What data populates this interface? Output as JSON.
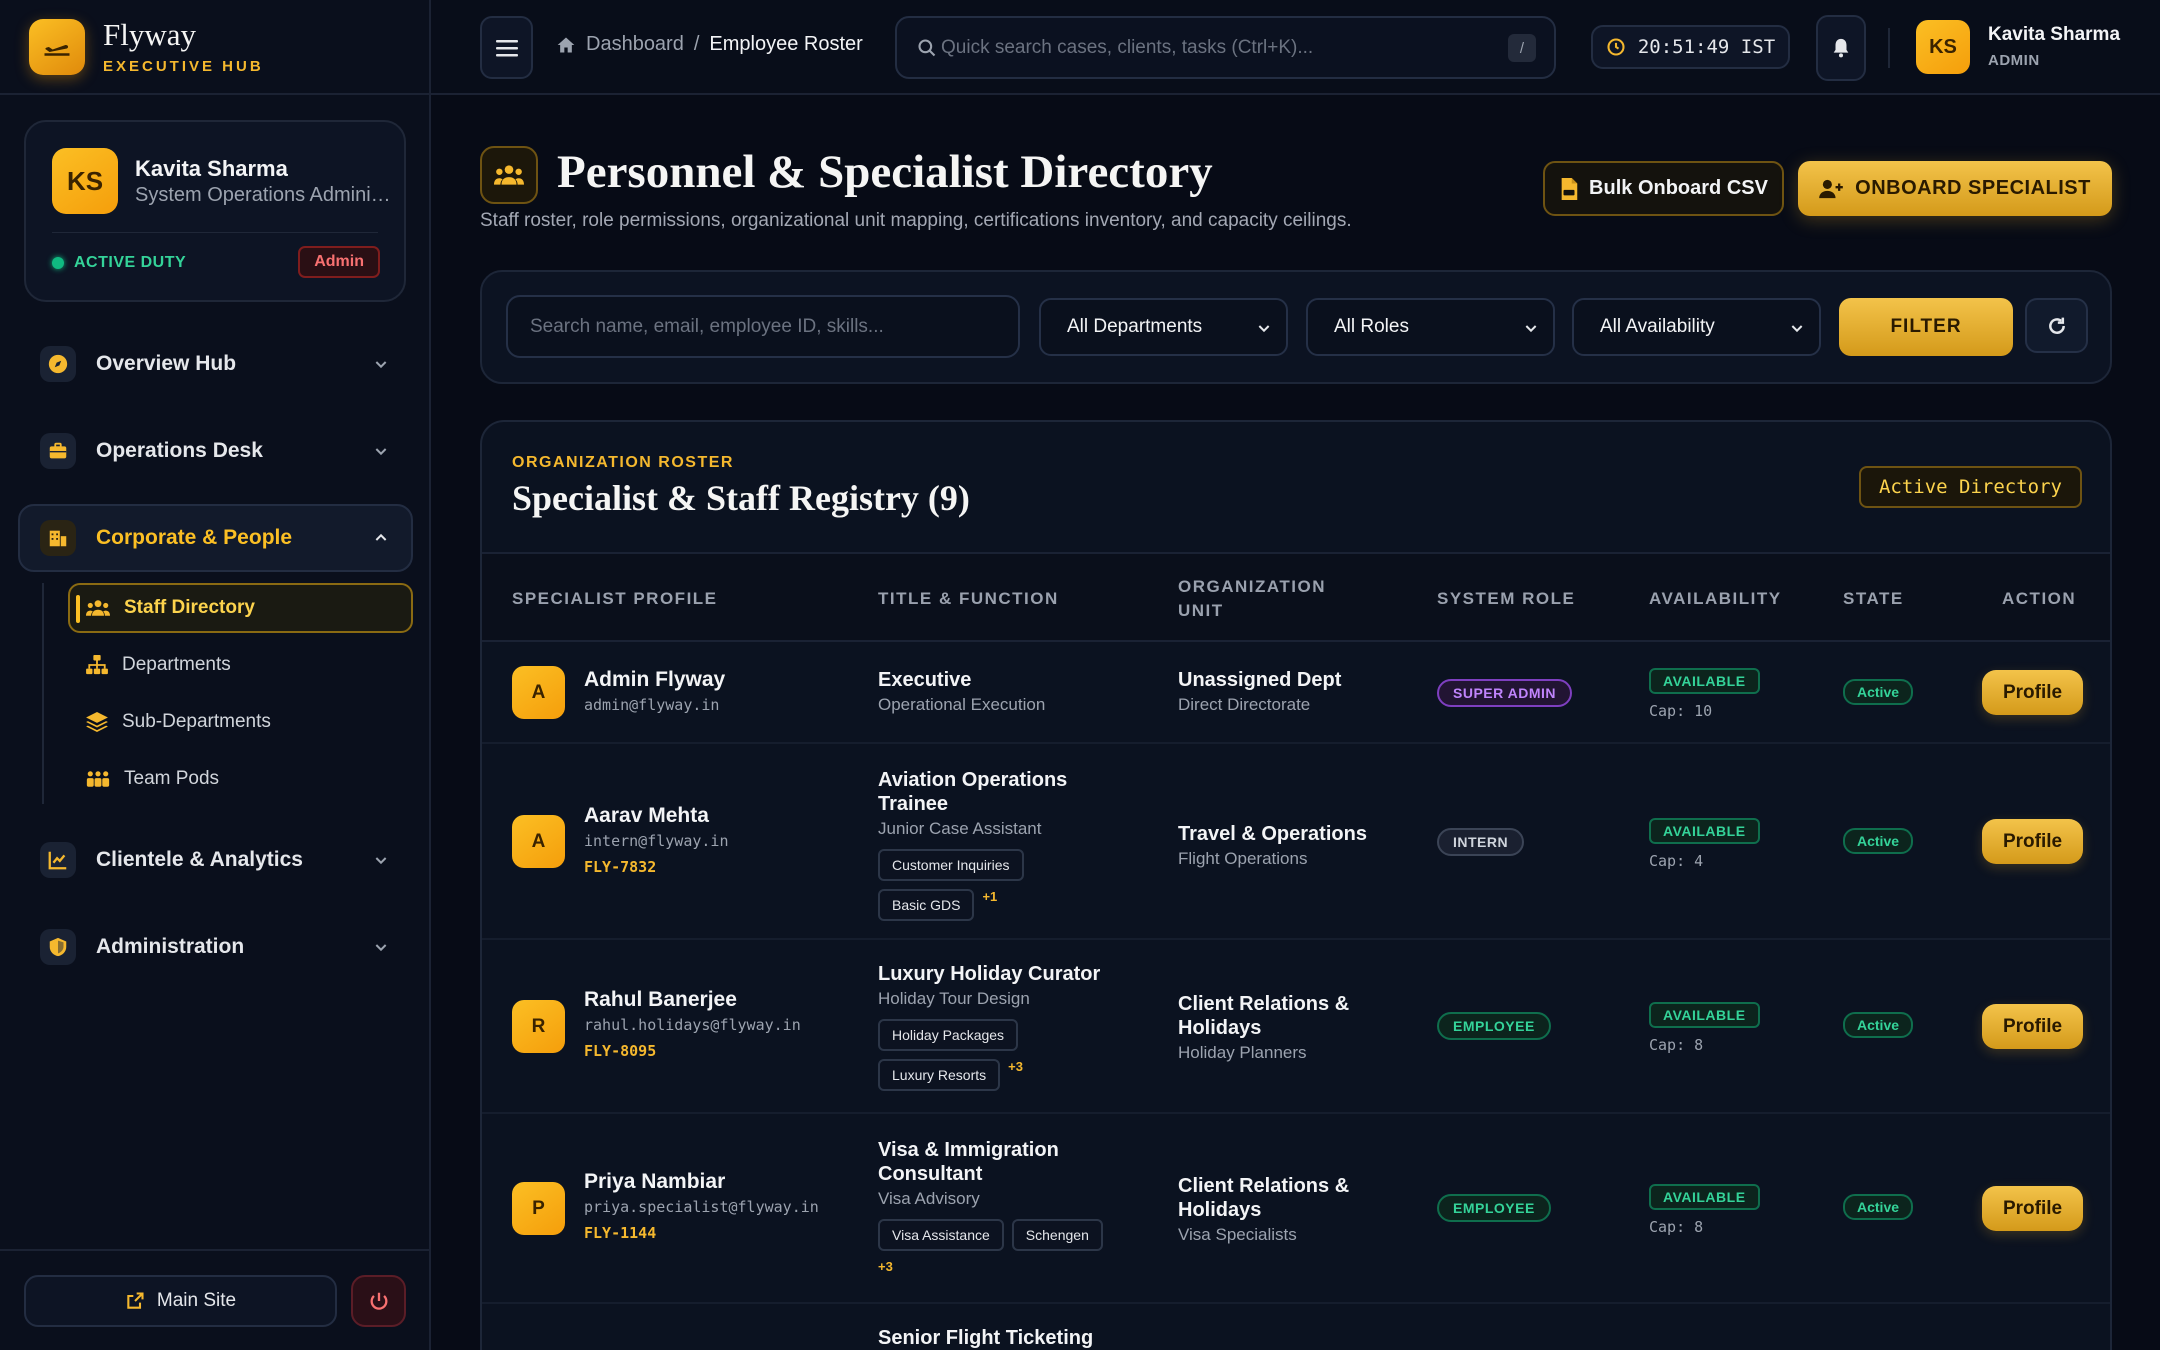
{
  "brand": {
    "name": "Flyway",
    "subtitle": "EXECUTIVE HUB"
  },
  "user_card": {
    "initials": "KS",
    "name": "Kavita Sharma",
    "role": "System Operations Administrator",
    "status": "ACTIVE DUTY",
    "badge": "Admin"
  },
  "nav": {
    "overview": "Overview Hub",
    "operations": "Operations Desk",
    "corporate": "Corporate & People",
    "sub": [
      "Staff Directory",
      "Departments",
      "Sub-Departments",
      "Team Pods"
    ],
    "clientele": "Clientele & Analytics",
    "administration": "Administration"
  },
  "footer": {
    "main_site": "Main Site"
  },
  "topbar": {
    "breadcrumb_home": "Dashboard",
    "breadcrumb_sep": "/",
    "breadcrumb_current": "Employee Roster",
    "search_placeholder": "Quick search cases, clients, tasks (Ctrl+K)...",
    "search_kbd": "/",
    "clock": "20:51:49 IST",
    "user_initials": "KS",
    "user_name": "Kavita Sharma",
    "user_role": "ADMIN"
  },
  "page": {
    "title": "Personnel & Specialist Directory",
    "subtitle": "Staff roster, role permissions, organizational unit mapping, certifications inventory, and capacity ceilings.",
    "bulk_btn": "Bulk Onboard CSV",
    "onboard_btn": "ONBOARD SPECIALIST"
  },
  "filters": {
    "search_placeholder": "Search name, email, employee ID, skills...",
    "department": "All Departments",
    "role": "All Roles",
    "availability": "All Availability",
    "filter_btn": "FILTER"
  },
  "panel": {
    "kicker": "ORGANIZATION ROSTER",
    "title": "Specialist & Staff Registry (9)",
    "badge": "Active Directory"
  },
  "table": {
    "headers": {
      "profile": "SPECIALIST PROFILE",
      "title": "TITLE & FUNCTION",
      "unit_line1": "ORGANIZATION",
      "unit_line2": "UNIT",
      "role": "SYSTEM ROLE",
      "availability": "AVAILABILITY",
      "state": "STATE",
      "action": "ACTION"
    },
    "rows": [
      {
        "initial": "A",
        "name": "Admin Flyway",
        "email": "admin@flyway.in",
        "emp_id": "",
        "title": "Executive",
        "function": "Operational Execution",
        "skills": [],
        "more": "",
        "unit": "Unassigned Dept",
        "unit_sub": "Direct Directorate",
        "role": "SUPER ADMIN",
        "availability": "AVAILABLE",
        "cap": "Cap: 10",
        "state": "Active",
        "action": "Profile"
      },
      {
        "initial": "A",
        "name": "Aarav Mehta",
        "email": "intern@flyway.in",
        "emp_id": "FLY-7832",
        "title": "Aviation Operations Trainee",
        "function": "Junior Case Assistant",
        "skills": [
          "Customer Inquiries",
          "Basic GDS"
        ],
        "more": "+1",
        "unit": "Travel & Operations",
        "unit_sub": "Flight Operations",
        "role": "INTERN",
        "availability": "AVAILABLE",
        "cap": "Cap: 4",
        "state": "Active",
        "action": "Profile"
      },
      {
        "initial": "R",
        "name": "Rahul Banerjee",
        "email": "rahul.holidays@flyway.in",
        "emp_id": "FLY-8095",
        "title": "Luxury Holiday Curator",
        "function": "Holiday Tour Design",
        "skills": [
          "Holiday Packages",
          "Luxury Resorts"
        ],
        "more": "+3",
        "unit": "Client Relations & Holidays",
        "unit_sub": "Holiday Planners",
        "role": "EMPLOYEE",
        "availability": "AVAILABLE",
        "cap": "Cap: 8",
        "state": "Active",
        "action": "Profile"
      },
      {
        "initial": "P",
        "name": "Priya Nambiar",
        "email": "priya.specialist@flyway.in",
        "emp_id": "FLY-1144",
        "title": "Visa & Immigration Consultant",
        "function": "Visa Advisory",
        "skills": [
          "Visa Assistance",
          "Schengen"
        ],
        "more": "+3",
        "unit": "Client Relations & Holidays",
        "unit_sub": "Visa Specialists",
        "role": "EMPLOYEE",
        "availability": "AVAILABLE",
        "cap": "Cap: 8",
        "state": "Active",
        "action": "Profile"
      }
    ],
    "partial_row_title": "Senior Flight Ticketing"
  },
  "colors": {
    "accent": "#f5b82e",
    "background": "#070b16",
    "success": "#34d399"
  }
}
